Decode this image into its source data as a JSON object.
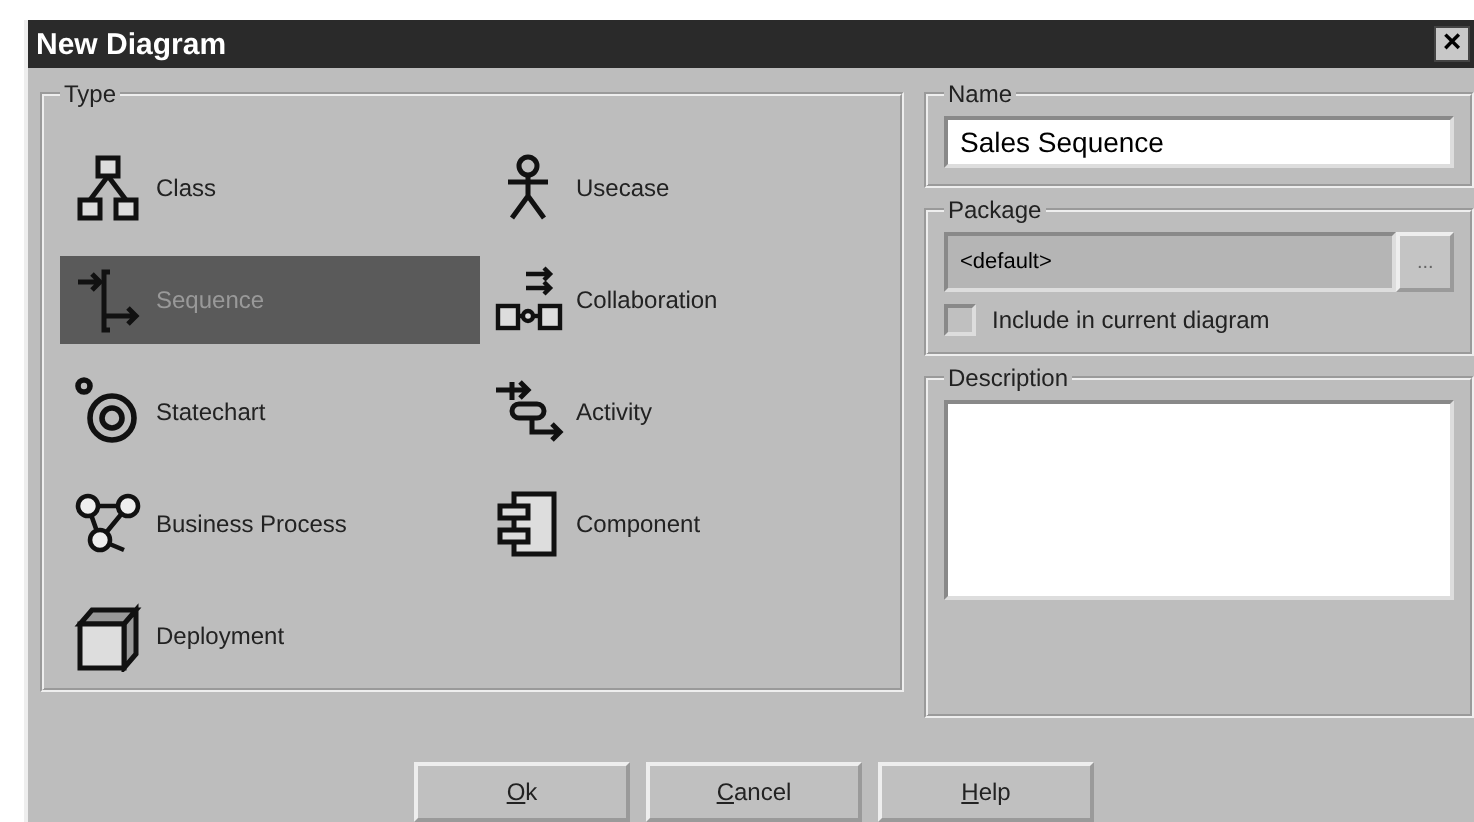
{
  "window": {
    "title": "New Diagram",
    "close": "×"
  },
  "type_group": {
    "label": "Type",
    "items": [
      {
        "label": "Class",
        "kind": "class",
        "selected": false
      },
      {
        "label": "Usecase",
        "kind": "usecase",
        "selected": false
      },
      {
        "label": "Sequence",
        "kind": "sequence",
        "selected": true
      },
      {
        "label": "Collaboration",
        "kind": "collaboration",
        "selected": false
      },
      {
        "label": "Statechart",
        "kind": "statechart",
        "selected": false
      },
      {
        "label": "Activity",
        "kind": "activity",
        "selected": false
      },
      {
        "label": "Business Process",
        "kind": "business",
        "selected": false
      },
      {
        "label": "Component",
        "kind": "component",
        "selected": false
      },
      {
        "label": "Deployment",
        "kind": "deployment",
        "selected": false
      }
    ]
  },
  "name_group": {
    "label": "Name",
    "value": "Sales Sequence"
  },
  "package_group": {
    "label": "Package",
    "value": "<default>",
    "browse": "...",
    "include_label": "Include in current diagram",
    "include_checked": false
  },
  "description_group": {
    "label": "Description"
  },
  "buttons": [
    "Ok",
    "Cancel",
    "Help"
  ]
}
